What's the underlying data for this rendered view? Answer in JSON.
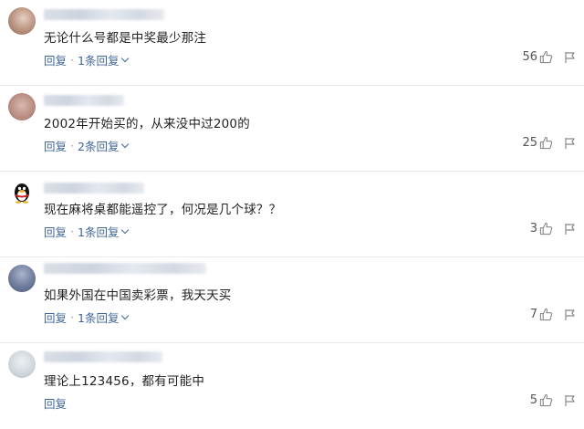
{
  "comments": [
    {
      "text": "无论什么号都是中奖最少那注",
      "reply_label": "回复",
      "replies_label": "1条回复",
      "likes": "56",
      "avatar_color": "#c9a795"
    },
    {
      "text": "2002年开始买的，从来没中过200的",
      "reply_label": "回复",
      "replies_label": "2条回复",
      "likes": "25",
      "avatar_color": "#c7a8a0"
    },
    {
      "text": "现在麻将桌都能遥控了，何况是几个球？？",
      "reply_label": "回复",
      "replies_label": "1条回复",
      "likes": "3",
      "avatar_color": "#1a1a1a"
    },
    {
      "text": "如果外国在中国卖彩票，我天天买",
      "reply_label": "回复",
      "replies_label": "1条回复",
      "likes": "7",
      "avatar_color": "#7a87a6"
    },
    {
      "text": "理论上123456，都有可能中",
      "reply_label": "回复",
      "replies_label": "",
      "likes": "5",
      "avatar_color": "#c8cdd3"
    }
  ],
  "icons": {
    "like": "thumbs-up-icon",
    "report": "flag-icon",
    "expand": "chevron-down-icon"
  }
}
